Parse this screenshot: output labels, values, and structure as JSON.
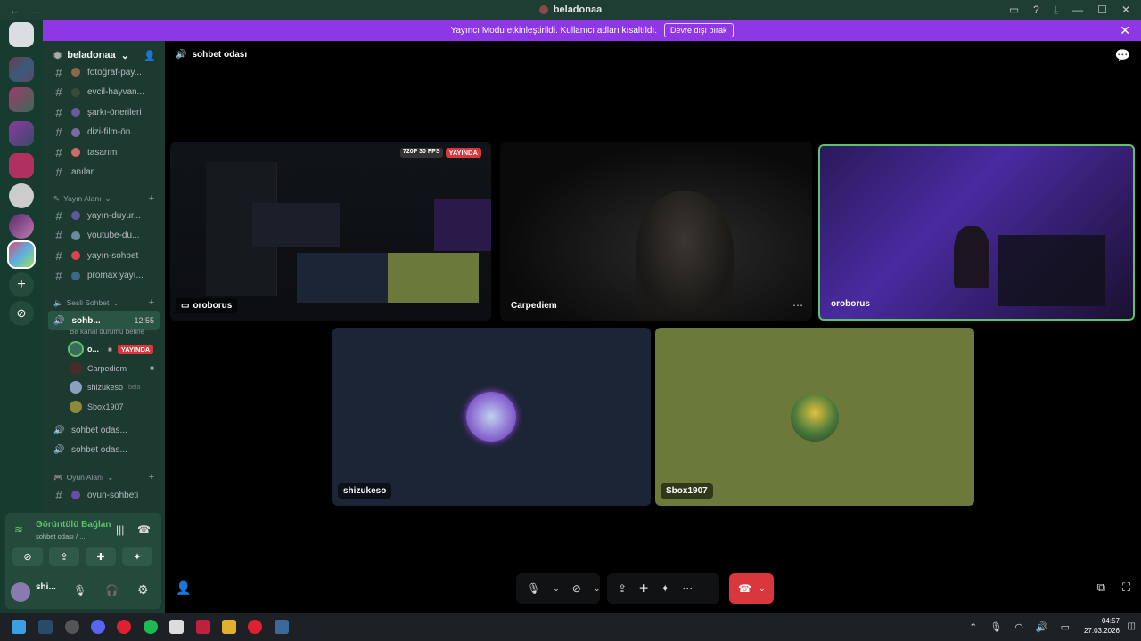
{
  "window": {
    "title": "beladonaa"
  },
  "notice": {
    "text": "Yayıncı Modu etkinleştirildi. Kullanıcı adları kısaltıldı.",
    "button": "Devre dışı bırak"
  },
  "server": {
    "name": "beladonaa"
  },
  "channels_top": [
    {
      "name": "fotoğraf-pay...",
      "emoji_color": "#8a6a4a"
    },
    {
      "name": "evcil-hayvan...",
      "emoji_color": "#3a4a3a"
    },
    {
      "name": "şarkı-önerileri",
      "emoji_color": "#6a5aa0"
    },
    {
      "name": "dizi-film-ön...",
      "emoji_color": "#7a6aa0"
    },
    {
      "name": "tasarım",
      "emoji_color": "#d06a6a"
    },
    {
      "name": "anılar",
      "emoji_color": ""
    }
  ],
  "category_stream": {
    "label": "Yayın Alanı"
  },
  "channels_stream": [
    {
      "name": "yayın-duyur...",
      "icon": "hash",
      "emoji_color": "#5a5a9a"
    },
    {
      "name": "youtube-du...",
      "icon": "hash",
      "emoji_color": "#6a8aa0"
    },
    {
      "name": "yayın-sohbet",
      "icon": "hash",
      "emoji_color": "#e04050"
    },
    {
      "name": "promax yayı...",
      "icon": "headset",
      "emoji_color": "#3a6a8a"
    }
  ],
  "category_voice": {
    "label": "Sesli Sohbet"
  },
  "active_voice": {
    "name": "sohb...",
    "time": "12:55",
    "status": "Bir kanal durumu belirle"
  },
  "voice_members": [
    {
      "name": "o...",
      "live": "YAYINDA",
      "avatar_color": "#3a6a5a"
    },
    {
      "name": "Carpediem",
      "live": "",
      "avatar_color": "#4a2a2a"
    },
    {
      "name": "shizukeso",
      "live": "",
      "extra": "bela",
      "avatar_color": "#8aa0c0"
    },
    {
      "name": "Sbox1907",
      "live": "",
      "avatar_color": "#8a8a3a"
    }
  ],
  "voice_channels_more": [
    {
      "name": "sohbet odas..."
    },
    {
      "name": "sohbet odas..."
    }
  ],
  "category_game": {
    "label": "Oyun Alanı"
  },
  "channels_game": [
    {
      "name": "oyun-sohbeti",
      "emoji_color": "#6a4ab0"
    }
  ],
  "voice_panel": {
    "title": "Görüntülü Bağlan",
    "subtitle": "sohbet odası / ..."
  },
  "user": {
    "name": "shi..."
  },
  "stage": {
    "channel": "sohbet odası"
  },
  "tiles": {
    "screen_share": {
      "name": "oroborus",
      "badge_quality": "720P 30 FPS",
      "badge_live": "YAYINDA"
    },
    "cam_carpediem": {
      "name": "Carpediem"
    },
    "cam_oroborus": {
      "name": "oroborus"
    },
    "shizukeso": {
      "name": "shizukeso"
    },
    "sbox": {
      "name": "Sbox1907"
    }
  },
  "tray": {
    "time": "04:57",
    "date": "27.03.2026"
  },
  "colors": {
    "accent": "#8d37e6",
    "live_red": "#da373c",
    "speaking_green": "#5ec26a",
    "hangup": "#da373c"
  }
}
